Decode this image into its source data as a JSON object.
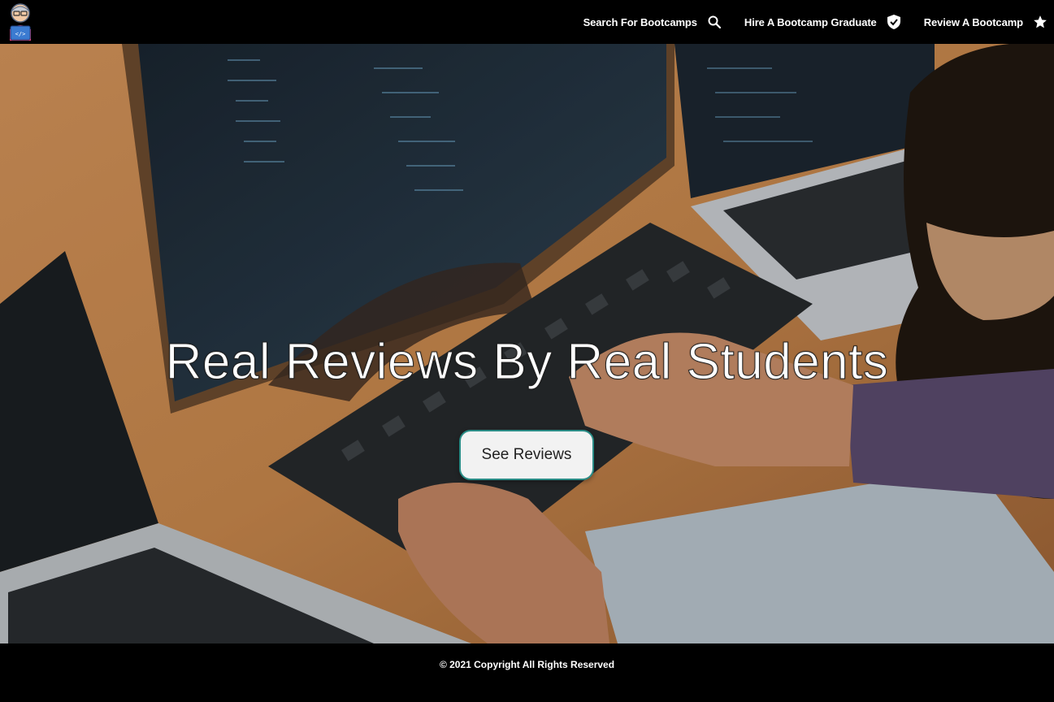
{
  "nav": {
    "logo_icon": "developer-avatar-icon",
    "links": [
      {
        "label": "Search For Bootcamps",
        "icon": "search-icon"
      },
      {
        "label": "Hire A Bootcamp Graduate",
        "icon": "shield-check-icon"
      },
      {
        "label": "Review A Bootcamp",
        "icon": "star-icon"
      }
    ]
  },
  "hero": {
    "title": "Real Reviews By Real Students",
    "button_label": "See Reviews",
    "background": "developer-typing-on-keyboard-photo",
    "button_border_color": "#2a8c86"
  },
  "footer": {
    "copyright": "© 2021 Copyright All Rights Reserved"
  }
}
